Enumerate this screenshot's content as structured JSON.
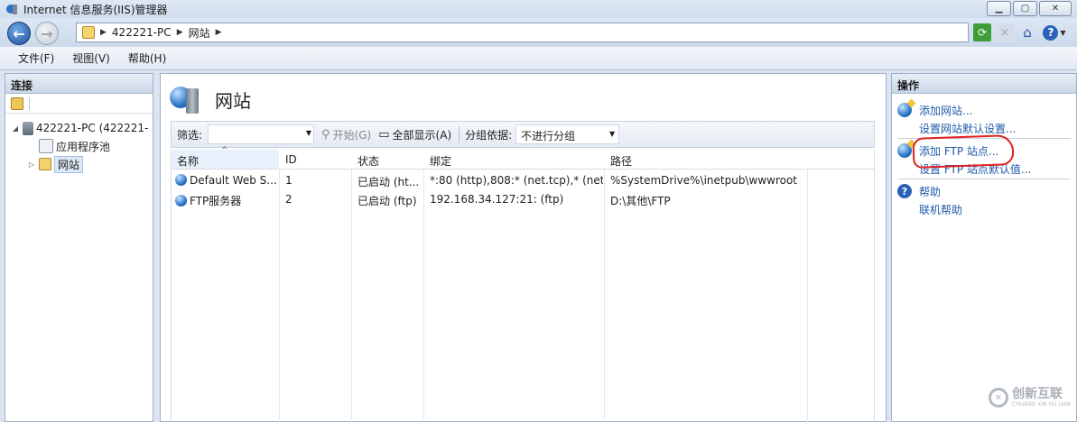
{
  "window": {
    "title": "Internet 信息服务(IIS)管理器"
  },
  "address": {
    "crumbs": [
      "422221-PC",
      "网站"
    ]
  },
  "menu": [
    "文件(F)",
    "视图(V)",
    "帮助(H)"
  ],
  "connections": {
    "header": "连接",
    "tree": {
      "server": "422221-PC (422221-",
      "app_pools": "应用程序池",
      "sites": "网站"
    }
  },
  "main": {
    "title": "网站",
    "filter": {
      "label": "筛选:",
      "value": "",
      "go": "开始(G)",
      "show_all": "全部显示(A)",
      "group_label": "分组依据:",
      "group_value": "不进行分组"
    },
    "columns": [
      "名称",
      "ID",
      "状态",
      "绑定",
      "路径"
    ],
    "rows": [
      {
        "name": "Default Web S...",
        "id": "1",
        "status": "已启动 (ht...",
        "binding": "*:80 (http),808:* (net.tcp),* (net....",
        "path": "%SystemDrive%\\inetpub\\wwwroot"
      },
      {
        "name": "FTP服务器",
        "id": "2",
        "status": "已启动 (ftp)",
        "binding": "192.168.34.127:21: (ftp)",
        "path": "D:\\其他\\FTP"
      }
    ]
  },
  "actions": {
    "header": "操作",
    "add_site": "添加网站...",
    "site_defaults": "设置网站默认设置...",
    "add_ftp": "添加 FTP 站点...",
    "ftp_defaults": "设置 FTP 站点默认值...",
    "help": "帮助",
    "online_help": "联机帮助"
  },
  "watermark": {
    "brand": "创新互联",
    "sub": "CHUANG XIN HU LIAN"
  },
  "colors": {
    "link": "#1e5aa8",
    "highlight": "#e02020"
  }
}
